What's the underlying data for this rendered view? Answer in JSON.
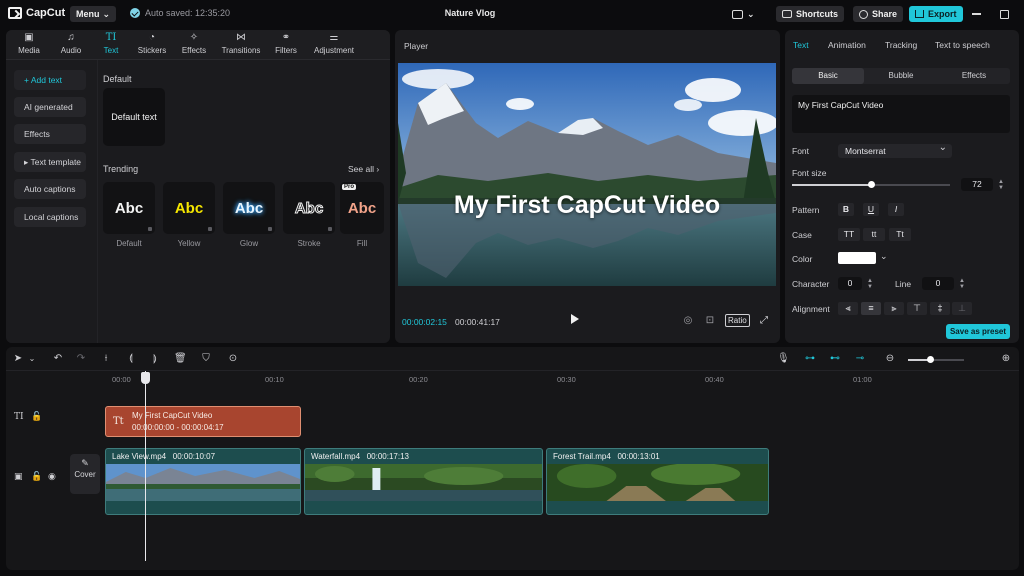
{
  "titlebar": {
    "app_name": "CapCut",
    "menu_label": "Menu",
    "autosave": "Auto saved: 12:35:20",
    "project_title": "Nature Vlog",
    "shortcuts_label": "Shortcuts",
    "share_label": "Share",
    "export_label": "Export"
  },
  "media": {
    "tabs": [
      {
        "label": "Media",
        "icon": "media-icon"
      },
      {
        "label": "Audio",
        "icon": "audio-icon"
      },
      {
        "label": "Text",
        "icon": "text-icon"
      },
      {
        "label": "Stickers",
        "icon": "stickers-icon"
      },
      {
        "label": "Effects",
        "icon": "effects-icon"
      },
      {
        "label": "Transitions",
        "icon": "transitions-icon"
      },
      {
        "label": "Filters",
        "icon": "filters-icon"
      },
      {
        "label": "Adjustment",
        "icon": "adjustment-icon"
      }
    ],
    "active_tab": "Text",
    "side_items": [
      "+ Add text",
      "AI generated",
      "Effects",
      "▸ Text template",
      "Auto captions",
      "Local captions"
    ],
    "default_heading": "Default",
    "default_card": "Default text",
    "trending_heading": "Trending",
    "see_all": "See all",
    "styles": [
      {
        "label": "Default",
        "sample": "Abc"
      },
      {
        "label": "Yellow",
        "sample": "Abc"
      },
      {
        "label": "Glow",
        "sample": "Abc"
      },
      {
        "label": "Stroke",
        "sample": "Abc"
      },
      {
        "label": "Fill",
        "sample": "Abc",
        "badge": "Pro"
      }
    ]
  },
  "player": {
    "title": "Player",
    "caption": "My First CapCut Video",
    "current_time": "00:00:02:15",
    "total_time": "00:00:41:17",
    "ratio_label": "Ratio"
  },
  "props": {
    "tabs": [
      "Text",
      "Animation",
      "Tracking",
      "Text to speech"
    ],
    "active_tab": "Text",
    "segments": [
      "Basic",
      "Bubble",
      "Effects"
    ],
    "active_segment": "Basic",
    "text_value": "My First CapCut Video",
    "font_label": "Font",
    "font_value": "Montserrat",
    "font_size_label": "Font size",
    "font_size_value": "72",
    "font_size_level": 0.5,
    "pattern_label": "Pattern",
    "pattern_buttons": [
      "B",
      "U",
      "I"
    ],
    "case_label": "Case",
    "case_buttons": [
      "TT",
      "tt",
      "Tt"
    ],
    "color_label": "Color",
    "color_value": "#ffffff",
    "character_label": "Character",
    "character_value": "0",
    "line_label": "Line",
    "line_value": "0",
    "alignment_label": "Alignment",
    "save_preset_label": "Save as preset"
  },
  "timeline": {
    "ruler": [
      "00:00",
      "00:10",
      "00:20",
      "00:30",
      "00:40",
      "01:00"
    ],
    "zoom_level": 0.4,
    "cover_label": "Cover",
    "text_clip": {
      "name": "My First CapCut Video",
      "time": "00:00:00:00 - 00:00:04:17"
    },
    "video_clips": [
      {
        "name": "Lake View.mp4",
        "duration": "00:00:10:07"
      },
      {
        "name": "Waterfall.mp4",
        "duration": "00:00:17:13"
      },
      {
        "name": "Forest Trail.mp4",
        "duration": "00:00:13:01"
      }
    ]
  },
  "colors": {
    "accent": "#20c7d9",
    "text_clip": "#a8452f",
    "video_clip": "#1d4d4e",
    "panel": "#1b1b1e"
  }
}
